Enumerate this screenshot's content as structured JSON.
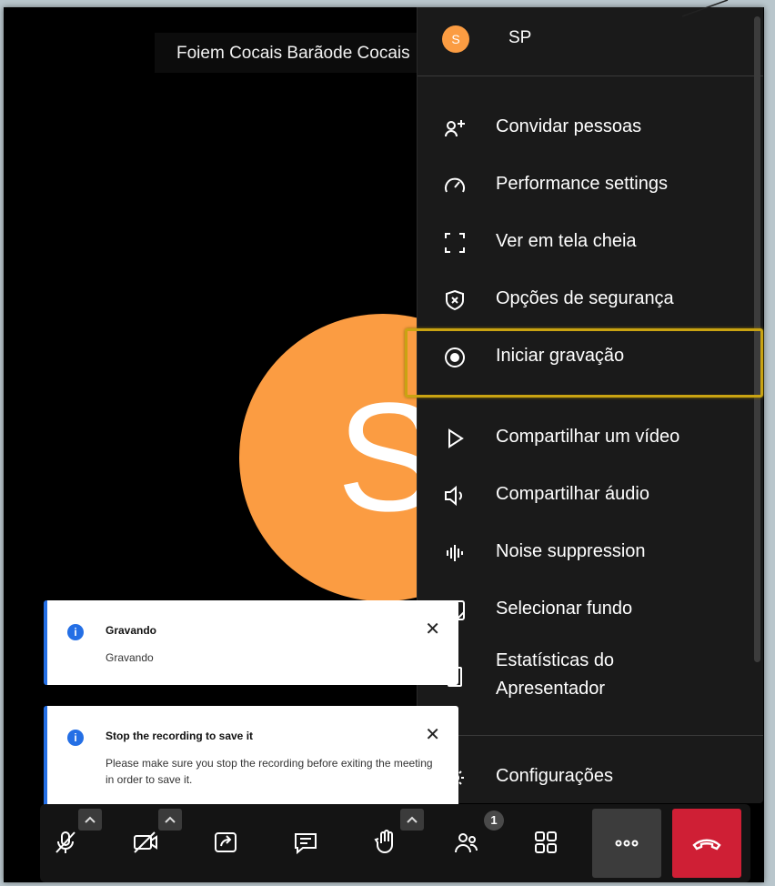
{
  "meeting": {
    "title": "Foiem Cocais Barãode Cocais",
    "avatar_letter": "S"
  },
  "menu": {
    "user": {
      "initial": "S",
      "name": "SP"
    },
    "items": [
      {
        "label": "Convidar pessoas",
        "icon": "add-person-icon"
      },
      {
        "label": "Performance settings",
        "icon": "gauge-icon"
      },
      {
        "label": "Ver em tela cheia",
        "icon": "fullscreen-icon"
      },
      {
        "label": "Opções de segurança",
        "icon": "shield-icon"
      },
      {
        "label": "Iniciar gravação",
        "icon": "record-icon"
      },
      {
        "label": "Compartilhar um vídeo",
        "icon": "play-icon"
      },
      {
        "label": "Compartilhar áudio",
        "icon": "speaker-icon"
      },
      {
        "label": "Noise suppression",
        "icon": "waveform-icon"
      },
      {
        "label": "Selecionar fundo",
        "icon": "background-icon"
      },
      {
        "label": "Estatísticas do Apresentador",
        "icon": "stats-icon"
      },
      {
        "label": "Configurações",
        "icon": "gear-icon"
      }
    ]
  },
  "notifications": [
    {
      "title": "Gravando",
      "body": "Gravando"
    },
    {
      "title": "Stop the recording to save it",
      "body": "Please make sure you stop the recording before exiting the meeting in order to save it."
    }
  ],
  "toolbar": {
    "participants_badge": "1"
  },
  "colors": {
    "accent": "#246fe5",
    "avatar": "#fb9c42",
    "hangup": "#cf1f35",
    "highlight": "#c9a312"
  }
}
